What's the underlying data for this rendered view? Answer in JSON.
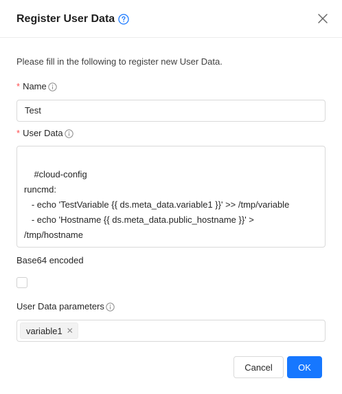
{
  "dialog": {
    "title": "Register User Data",
    "intro": "Please fill in the following to register new User Data."
  },
  "fields": {
    "name": {
      "required_mark": "*",
      "label": "Name",
      "value": "Test"
    },
    "user_data": {
      "required_mark": "*",
      "label": "User Data",
      "value": "#cloud-config\nruncmd:\n   - echo 'TestVariable {{ ds.meta_data.variable1 }}' >> /tmp/variable\n   - echo 'Hostname {{ ds.meta_data.public_hostname }}' >\n/tmp/hostname"
    },
    "base64": {
      "label": "Base64 encoded",
      "checked": false
    },
    "parameters": {
      "label": "User Data parameters",
      "tags": [
        "variable1"
      ]
    }
  },
  "buttons": {
    "cancel": "Cancel",
    "ok": "OK"
  },
  "colors": {
    "primary": "#1677ff",
    "required": "#ff4d4f",
    "border": "#d9d9d9"
  },
  "icons": {
    "help": "question-circle-icon",
    "info": "info-circle-icon",
    "close": "close-icon",
    "tag_close": "tag-close-icon"
  }
}
